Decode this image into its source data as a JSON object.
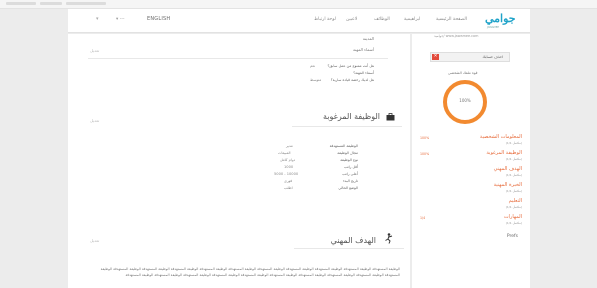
{
  "colors": {
    "brand": "#1fa3c9",
    "accent": "#e76c3c",
    "ring": "#f28a30",
    "danger": "#e24a3b"
  },
  "nav": {
    "lang": "ENGLISH",
    "caret": "▾",
    "links": [
      "الصفحة الرئيسية",
      "ابراهيمية",
      "الوظائف",
      "لاعبين",
      "لوحة ارتباط",
      "اتصل بنا"
    ],
    "logo": "جوامي",
    "logo_tagline": "JAWAMEE"
  },
  "main": {
    "sections": [
      {
        "title": "",
        "edit_label": "تعديل",
        "top_lines": [
          "المدينة",
          "أسماء المهنة"
        ],
        "rows": [
          {
            "key": "هل أنت ممنوع من عمل سابق؟",
            "val": "نعم"
          },
          {
            "key": "أسماء المهنة؟",
            "val": ""
          },
          {
            "key": "هل لديك رخصة قيادة سارية؟",
            "val": "متوسط"
          }
        ]
      },
      {
        "title": "الوظيفة المرغوبة",
        "edit_label": "تعديل",
        "rows": [
          {
            "key": "الوظيفة المستهدفة",
            "val": "مدير"
          },
          {
            "key": "مجال الوظيفة",
            "val": "المبيعات"
          },
          {
            "key": "نوع الوظيفة",
            "val": "دوام كامل"
          },
          {
            "key": "أقل راتب",
            "val": "1000"
          },
          {
            "key": "أعلى راتب",
            "val": "5000 - 10000"
          },
          {
            "key": "تاريخ البدء",
            "val": "فوري"
          },
          {
            "key": "الوضع الحالي",
            "val": "اطلب"
          }
        ]
      },
      {
        "title": "الهدف المهني",
        "edit_label": "تعديل",
        "paragraph": "الوظيفة المستهدفة الوظيفة المستهدفة الوظيفة المستهدفة الوظيفة المستهدفة الوظيفة المستهدفة الوظيفة المستهدفة الوظيفة المستهدفة الوظيفة المستهدفة الوظيفة المستهدفة الوظيفة المستهدفة الوظيفة المستهدفة الوظيفة المستهدفة الوظيفة المستهدفة الوظيفة المستهدفة الوظيفة المستهدفة الوظيفة المستهدفة الوظيفة المستهدفة الوظيفة المستهدفة الوظيفة المستهدفة الوظيفة المستهدفة"
      }
    ]
  },
  "sidebar": {
    "url": "جواميد/ www.jawamee.com",
    "delete_button": "احذف حسابك",
    "delete_x": "✕",
    "strength_label": "قوة ملفك الشخصي",
    "strength_value": "100%",
    "strength_fraction": 1.0,
    "items": [
      {
        "title": "المعلومات الشخصية",
        "sub": "(مكتمل 1/1)",
        "pct": "100%"
      },
      {
        "title": "الوظيفة المرغوبة",
        "sub": "(مكتمل 1/1)",
        "pct": "100%"
      },
      {
        "title": "الهدف المهني",
        "sub": "(مكتمل 1/1)",
        "pct": ""
      },
      {
        "title": "الخبرة المهنية",
        "sub": "(مكتمل 1/1)",
        "pct": ""
      },
      {
        "title": "التعليم",
        "sub": "(مكتمل 1/1)",
        "pct": ""
      },
      {
        "title": "المهارات",
        "sub": "(مكتمل 1/1)",
        "pct": "1/4"
      }
    ],
    "prefs": "Prefs"
  }
}
